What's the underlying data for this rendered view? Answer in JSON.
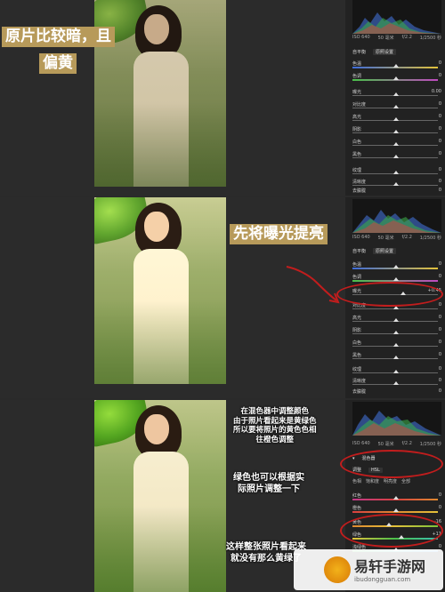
{
  "panel1": {
    "title_line1": "原片比较暗，且",
    "title_line2": "偏黄",
    "camera_info": [
      "ISO 640",
      "50 毫米",
      "f/2.2",
      "1/2500 秒"
    ],
    "profile_label": "自平衡",
    "profile_value": "原照设置",
    "sliders": [
      {
        "label": "色温",
        "value": "0"
      },
      {
        "label": "色调",
        "value": "0"
      },
      {
        "label": "曝光",
        "value": "0.00"
      },
      {
        "label": "对比度",
        "value": "0"
      },
      {
        "label": "高光",
        "value": "0"
      },
      {
        "label": "阴影",
        "value": "0"
      },
      {
        "label": "白色",
        "value": "0"
      },
      {
        "label": "黑色",
        "value": "0"
      },
      {
        "label": "纹理",
        "value": "0"
      },
      {
        "label": "清晰度",
        "value": "0"
      },
      {
        "label": "去朦胧",
        "value": "0"
      }
    ]
  },
  "panel2": {
    "title": "先将曝光提亮",
    "camera_info": [
      "ISO 640",
      "50 毫米",
      "f/2.2",
      "1/2500 秒"
    ],
    "profile_label": "自平衡",
    "profile_value": "原照设置",
    "sliders": [
      {
        "label": "色温",
        "value": "0"
      },
      {
        "label": "色调",
        "value": "0"
      },
      {
        "label": "曝光",
        "value": "+0.45"
      },
      {
        "label": "对比度",
        "value": "0"
      },
      {
        "label": "高光",
        "value": "0"
      },
      {
        "label": "阴影",
        "value": "0"
      },
      {
        "label": "白色",
        "value": "0"
      },
      {
        "label": "黑色",
        "value": "0"
      },
      {
        "label": "纹理",
        "value": "0"
      },
      {
        "label": "清晰度",
        "value": "0"
      },
      {
        "label": "去朦胧",
        "value": "0"
      }
    ]
  },
  "panel3": {
    "note1": [
      "在混色器中调整颜色",
      "由于照片看起来是黄绿色",
      "所以要将照片的黄色色相",
      "往橙色调整"
    ],
    "note2": [
      "绿色也可以根据实",
      "际照片调整一下"
    ],
    "note3": [
      "这样整张照片看起来",
      "就没有那么黄绿了"
    ],
    "camera_info": [
      "ISO 640",
      "50 毫米",
      "f/2.2",
      "1/2500 秒"
    ],
    "section_title": "混色器",
    "adjust_label": "调整",
    "adjust_value": "HSL",
    "tabs": [
      "色相",
      "饱和度",
      "明亮度",
      "全部"
    ],
    "sliders": [
      {
        "label": "红色",
        "value": "0"
      },
      {
        "label": "橙色",
        "value": "0"
      },
      {
        "label": "黄色",
        "value": "-16"
      },
      {
        "label": "绿色",
        "value": "+11"
      },
      {
        "label": "浅绿色",
        "value": "0"
      }
    ]
  },
  "watermark": {
    "name": "易轩手游网",
    "url": "ibudongguan.com"
  },
  "colors": {
    "background": "#2b2b2b",
    "title_bg": "#b79a5a",
    "annotation_red": "#c21d1d"
  }
}
